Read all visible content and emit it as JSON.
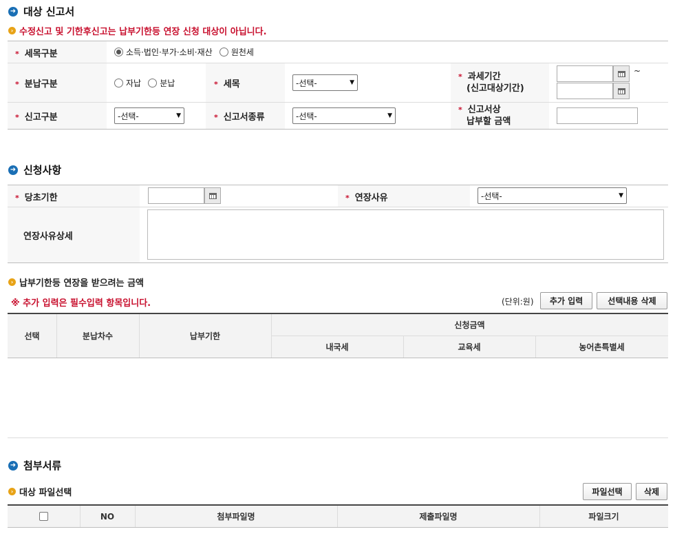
{
  "section1": {
    "title": "대상 신고서",
    "notice": "수정신고 및 기한후신고는 납부기한등 연장 신청 대상이 아닙니다.",
    "tax_category": {
      "label": "세목구분",
      "options": [
        "소득·법인·부가·소비·재산",
        "원천세"
      ],
      "selected": 0
    },
    "payment_type": {
      "label": "분납구분",
      "options": [
        "자납",
        "분납"
      ]
    },
    "tax_item": {
      "label": "세목",
      "value": "-선택-"
    },
    "tax_period": {
      "label_line1": "과세기간",
      "label_line2": "(신고대상기간)",
      "separator": "~"
    },
    "report_type": {
      "label": "신고구분",
      "value": "-선택-"
    },
    "report_kind": {
      "label": "신고서종류",
      "value": "-선택-"
    },
    "report_amount": {
      "label_line1": "신고서상",
      "label_line2": "납부할 금액"
    }
  },
  "section2": {
    "title": "신청사항",
    "original_deadline": {
      "label": "당초기한"
    },
    "extension_reason": {
      "label": "연장사유",
      "value": "-선택-"
    },
    "reason_detail": {
      "label": "연장사유상세"
    }
  },
  "amount_section": {
    "title": "납부기한등 연장을 받으려는 금액",
    "required_notice": "※ 추가 입력은 필수입력 항목입니다.",
    "unit": "(단위:원)",
    "add_button": "추가 입력",
    "delete_button": "선택내용 삭제",
    "columns": {
      "select": "선택",
      "installment": "분납차수",
      "deadline": "납부기한",
      "requested": "신청금액",
      "national": "내국세",
      "education": "교육세",
      "rural": "농어촌특별세"
    }
  },
  "section3": {
    "title": "첨부서류",
    "sub_title": "대상 파일선택",
    "file_select_button": "파일선택",
    "delete_button": "삭제",
    "columns": {
      "no": "NO",
      "attach_name": "첨부파일명",
      "submit_name": "제출파일명",
      "size": "파일크기"
    }
  },
  "icons": {
    "section_bullet": "arrow-circle-icon",
    "sub_bullet": "chevron-circle-icon",
    "calendar": "calendar-icon"
  },
  "colors": {
    "accent_blue": "#1a6fb5",
    "notice_red": "#c8102e",
    "bullet_orange": "#e8a317"
  }
}
